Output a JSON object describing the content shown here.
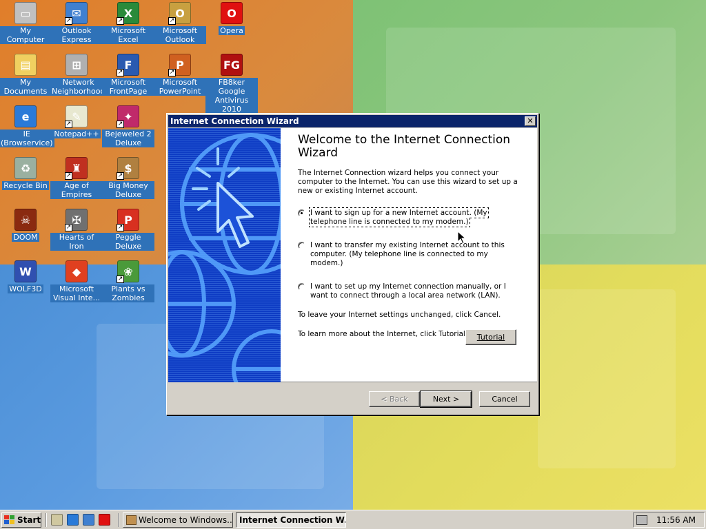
{
  "desktop": {
    "icons": [
      {
        "label": "My Computer",
        "icon": "computer-icon",
        "shortcut": false,
        "color": "#c0c0c0",
        "glyph": "▭"
      },
      {
        "label": "My Documents",
        "icon": "folder-documents-icon",
        "shortcut": false,
        "color": "#f0d060",
        "glyph": "▤"
      },
      {
        "label": "IE (Browservice)",
        "icon": "internet-explorer-icon",
        "shortcut": false,
        "color": "#2a7ad8",
        "glyph": "e"
      },
      {
        "label": "Recycle Bin",
        "icon": "recycle-bin-icon",
        "shortcut": false,
        "color": "#9ab0a0",
        "glyph": "♻"
      },
      {
        "label": "DOOM",
        "icon": "doom-icon",
        "shortcut": false,
        "color": "#8a2a10",
        "glyph": "☠"
      },
      {
        "label": "WOLF3D",
        "icon": "wolf3d-icon",
        "shortcut": false,
        "color": "#3050b0",
        "glyph": "W"
      },
      {
        "label": "Outlook Express",
        "icon": "outlook-express-icon",
        "shortcut": true,
        "color": "#4080d0",
        "glyph": "✉"
      },
      {
        "label": "Network Neighborhood",
        "icon": "network-icon",
        "shortcut": false,
        "color": "#b0b0b0",
        "glyph": "⊞"
      },
      {
        "label": "Notepad++",
        "icon": "notepad-icon",
        "shortcut": true,
        "color": "#e8e8d0",
        "glyph": "✎"
      },
      {
        "label": "Age of Empires",
        "icon": "age-of-empires-icon",
        "shortcut": true,
        "color": "#c03020",
        "glyph": "♜"
      },
      {
        "label": "Hearts of Iron",
        "icon": "hearts-of-iron-icon",
        "shortcut": true,
        "color": "#707070",
        "glyph": "✠"
      },
      {
        "label": "Microsoft Visual Inte...",
        "icon": "visual-interdev-icon",
        "shortcut": false,
        "color": "#e04020",
        "glyph": "◆"
      },
      {
        "label": "Microsoft Excel",
        "icon": "excel-icon",
        "shortcut": true,
        "color": "#2a8a3a",
        "glyph": "X"
      },
      {
        "label": "Microsoft FrontPage",
        "icon": "frontpage-icon",
        "shortcut": true,
        "color": "#2a5ab0",
        "glyph": "F"
      },
      {
        "label": "Bejeweled 2 Deluxe",
        "icon": "bejeweled-icon",
        "shortcut": true,
        "color": "#c02a6a",
        "glyph": "✦"
      },
      {
        "label": "Big Money Deluxe",
        "icon": "big-money-icon",
        "shortcut": true,
        "color": "#b08040",
        "glyph": "$"
      },
      {
        "label": "Peggle Deluxe",
        "icon": "peggle-icon",
        "shortcut": true,
        "color": "#d83020",
        "glyph": "P"
      },
      {
        "label": "Plants vs Zombies",
        "icon": "plants-vs-zombies-icon",
        "shortcut": true,
        "color": "#4a9a3a",
        "glyph": "❀"
      },
      {
        "label": "Microsoft Outlook",
        "icon": "outlook-icon",
        "shortcut": true,
        "color": "#c8a040",
        "glyph": "O"
      },
      {
        "label": "Microsoft PowerPoint",
        "icon": "powerpoint-icon",
        "shortcut": true,
        "color": "#d06020",
        "glyph": "P"
      },
      {
        "label": "Opera",
        "icon": "opera-icon",
        "shortcut": false,
        "color": "#e01010",
        "glyph": "O"
      },
      {
        "label": "FB8ker Google Antivirus 2010",
        "icon": "antivirus-icon",
        "shortcut": false,
        "color": "#b01010",
        "glyph": "FG"
      }
    ]
  },
  "wizard": {
    "window_title": "Internet Connection Wizard",
    "close_glyph": "✕",
    "heading": "Welcome to the Internet Connection Wizard",
    "intro": "The Internet Connection wizard helps you connect your computer to the Internet.  You can use this wizard to set up a new or existing Internet account.",
    "options": [
      {
        "label": "I want to sign up for a new Internet account. (My telephone line is connected to my modem.)",
        "selected": true
      },
      {
        "label": "I want to transfer my existing Internet account to this computer. (My telephone line is connected to my modem.)",
        "selected": false
      },
      {
        "label": "I want to set up my Internet connection manually, or I want to connect through a local area network (LAN).",
        "selected": false
      }
    ],
    "cancel_note": "To leave your Internet settings unchanged, click Cancel.",
    "tutorial_note": "To learn more about the Internet, click Tutorial.",
    "tutorial_label": "Tutorial",
    "back_label": "< Back",
    "next_label": "Next >",
    "cancel_label": "Cancel",
    "art_color": "#0e3cc4"
  },
  "taskbar": {
    "start_label": "Start",
    "quick_launch": [
      {
        "icon": "show-desktop-icon",
        "color": "#d0c8a0"
      },
      {
        "icon": "internet-explorer-icon",
        "color": "#2a7ad8"
      },
      {
        "icon": "outlook-express-icon",
        "color": "#4080d0"
      },
      {
        "icon": "opera-icon",
        "color": "#e01010"
      }
    ],
    "tasks": [
      {
        "label": "Welcome to Windows...",
        "active": false
      },
      {
        "label": "Internet Connection W...",
        "active": true
      }
    ],
    "clock": "11:56 AM"
  }
}
